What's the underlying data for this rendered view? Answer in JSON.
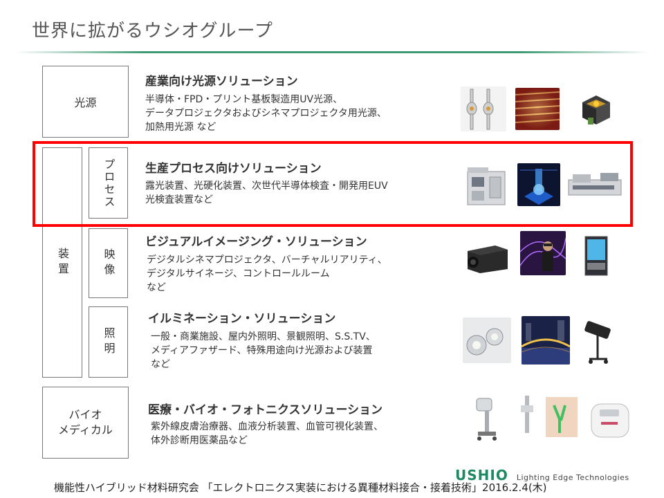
{
  "page": {
    "title": "世界に拡がるウシオグループ"
  },
  "categories": {
    "light_source": "光源",
    "equipment": "装置",
    "process": "プロセス",
    "imaging": "映像",
    "lighting": "照明",
    "bio_medical": "バイオ\nメディカル"
  },
  "sections": [
    {
      "title": "産業向け光源ソリューション",
      "desc": [
        "半導体・FPD・プリント基板製造用UV光源、",
        "データプロジェクタおよびシネマプロジェクタ用光源、",
        "加熱用光源 など"
      ],
      "images": [
        "uv-lamps-image",
        "heating-lamp-array-image",
        "light-source-module-image"
      ]
    },
    {
      "title": "生産プロセス向けソリューション",
      "desc": [
        "露光装置、光硬化装置、次世代半導体検査・開発用EUV",
        "光検査装置など"
      ],
      "images": [
        "exposure-equipment-image",
        "euv-inspection-image",
        "curing-equipment-image"
      ]
    },
    {
      "title": "ビジュアルイメージング・ソリューション",
      "desc": [
        "デジタルシネマプロジェクタ、バーチャルリアリティ、",
        "デジタルサイネージ、コントロールルーム",
        "など"
      ],
      "images": [
        "cinema-projector-image",
        "virtual-reality-image",
        "digital-signage-image"
      ]
    },
    {
      "title": "イルミネーション・ソリューション",
      "desc": [
        "一般・商業施設、屋内外照明、景観照明、S.S.TV、",
        "メディアファザード、特殊用途向け光源および装置",
        "など"
      ],
      "images": [
        "led-lamps-image",
        "bridge-illumination-image",
        "spotlight-image"
      ]
    },
    {
      "title": "医療・バイオ・フォトニクスソリューション",
      "desc": [
        "紫外線皮膚治療器、血液分析装置、血管可視化装置、",
        "体外診断用医薬品など"
      ],
      "images": [
        "phototherapy-device-image",
        "vein-visualization-image",
        "blood-analyzer-image"
      ]
    }
  ],
  "footer": {
    "text": "機能性ハイブリッド材料研究会 「エレクトロニクス実装における異種材料接合・接着技術」2016.2.4(木)",
    "logo": "USHIO",
    "tagline": "Lighting Edge Technologies"
  },
  "colors": {
    "highlight": "#ff0000",
    "brand_green": "#1d8a63"
  }
}
